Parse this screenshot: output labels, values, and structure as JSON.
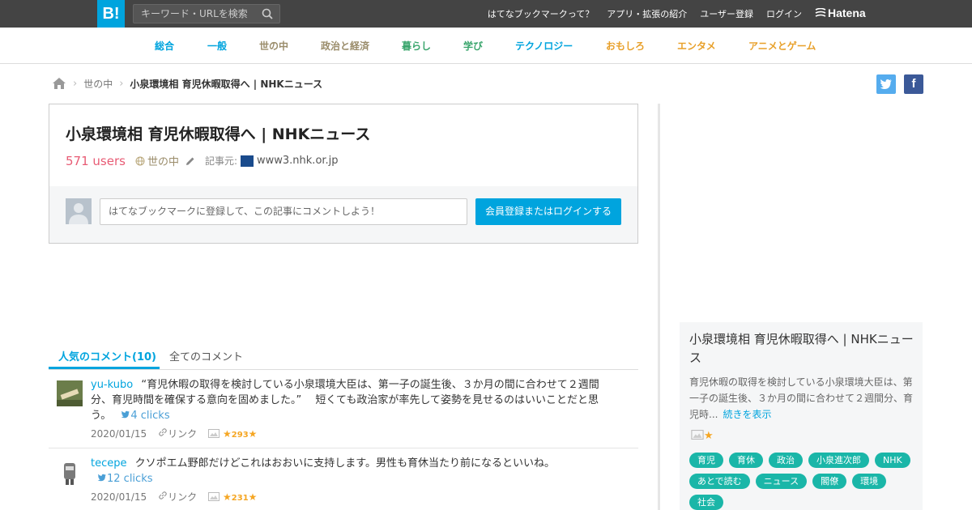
{
  "header": {
    "logo": "B!",
    "search_placeholder": "キーワード・URLを検索",
    "links": [
      "はてなブックマークって？",
      "アプリ・拡張の紹介",
      "ユーザー登録",
      "ログイン"
    ],
    "brand": "Hatena"
  },
  "categories": [
    {
      "label": "総合",
      "color": "#00a4de"
    },
    {
      "label": "一般",
      "color": "#00a4de"
    },
    {
      "label": "世の中",
      "color": "#9a8c6a"
    },
    {
      "label": "政治と経済",
      "color": "#9a8c6a"
    },
    {
      "label": "暮らし",
      "color": "#39a56c"
    },
    {
      "label": "学び",
      "color": "#39a56c"
    },
    {
      "label": "テクノロジー",
      "color": "#00a4de"
    },
    {
      "label": "おもしろ",
      "color": "#e8a02a"
    },
    {
      "label": "エンタメ",
      "color": "#e8a02a"
    },
    {
      "label": "アニメとゲーム",
      "color": "#e8a02a"
    }
  ],
  "breadcrumb": {
    "category": "世の中",
    "current": "小泉環境相 育児休暇取得へ | NHKニュース"
  },
  "entry": {
    "title": "小泉環境相 育児休暇取得へ | NHKニュース",
    "users": "571 users",
    "category": "世の中",
    "source_label": "記事元:",
    "domain": "www3.nhk.or.jp"
  },
  "comment_form": {
    "placeholder": "はてなブックマークに登録して、この記事にコメントしよう！",
    "button": "会員登録またはログインする"
  },
  "tabs": {
    "popular": "人気のコメント(10)",
    "all": "全てのコメント"
  },
  "comments": [
    {
      "user": "yu-kubo",
      "text": "“育児休暇の取得を検討している小泉環境大臣は、第一子の誕生後、３か月の間に合わせて２週間分、育児時間を確保する意向を固めました。” 　短くても政治家が率先して姿勢を見せるのはいいことだと思う。",
      "clicks": "4 clicks",
      "date": "2020/01/15",
      "link": "リンク",
      "stars": "293"
    },
    {
      "user": "tecepe",
      "text": "クソポエム野郎だけどこれはおおいに支持します。男性も育休当たり前になるといいね。",
      "clicks": "12 clicks",
      "date": "2020/01/15",
      "link": "リンク",
      "stars": "231"
    }
  ],
  "side": {
    "title": "小泉環境相 育児休暇取得へ | NHKニュース",
    "description": "育児休暇の取得を検討している小泉環境大臣は、第一子の誕生後、３か月の間に合わせて２週間分、育児時...",
    "more": "続きを表示",
    "tags": [
      "育児",
      "育休",
      "政治",
      "小泉進次郎",
      "NHK",
      "あとで読む",
      "ニュース",
      "閣僚",
      "環境",
      "社会"
    ]
  }
}
